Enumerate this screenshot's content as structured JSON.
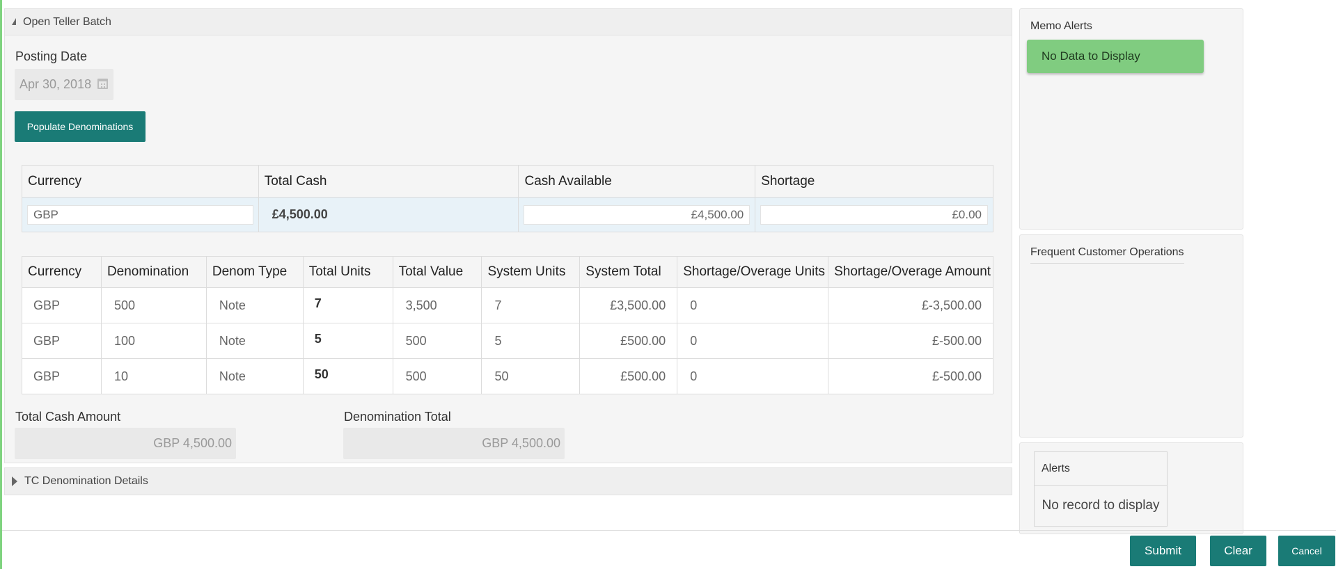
{
  "open_batch": {
    "header": "Open Teller Batch",
    "posting_date_label": "Posting Date",
    "posting_date_value": "Apr 30, 2018",
    "populate_button": "Populate Denominations"
  },
  "cash_table": {
    "columns": [
      "Currency",
      "Total Cash",
      "Cash Available",
      "Shortage"
    ],
    "row": {
      "currency": "GBP",
      "total_cash": "£4,500.00",
      "cash_available": "£4,500.00",
      "shortage": "£0.00"
    }
  },
  "denom_table": {
    "columns": [
      "Currency",
      "Denomination",
      "Denom Type",
      "Total Units",
      "Total Value",
      "System Units",
      "System Total",
      "Shortage/Overage Units",
      "Shortage/Overage Amount"
    ],
    "rows": [
      {
        "currency": "GBP",
        "denomination": "500",
        "denom_type": "Note",
        "total_units": "7",
        "total_value": "3,500",
        "system_units": "7",
        "system_total": "£3,500.00",
        "so_units": "0",
        "so_amount": "£-3,500.00"
      },
      {
        "currency": "GBP",
        "denomination": "100",
        "denom_type": "Note",
        "total_units": "5",
        "total_value": "500",
        "system_units": "5",
        "system_total": "£500.00",
        "so_units": "0",
        "so_amount": "£-500.00"
      },
      {
        "currency": "GBP",
        "denomination": "10",
        "denom_type": "Note",
        "total_units": "50",
        "total_value": "500",
        "system_units": "50",
        "system_total": "£500.00",
        "so_units": "0",
        "so_amount": "£-500.00"
      }
    ]
  },
  "totals": {
    "total_cash_label": "Total Cash Amount",
    "total_cash_value": "GBP 4,500.00",
    "denom_total_label": "Denomination Total",
    "denom_total_value": "GBP 4,500.00"
  },
  "tc_section": {
    "header": "TC Denomination Details"
  },
  "side": {
    "memo_alerts_title": "Memo Alerts",
    "memo_alerts_empty": "No Data to Display",
    "frequent_ops_title": "Frequent Customer Operations",
    "alerts_title": "Alerts",
    "alerts_empty": "No record to display"
  },
  "footer": {
    "submit": "Submit",
    "clear": "Clear",
    "cancel": "Cancel"
  },
  "colors": {
    "primary_button": "#1a7b76",
    "success_banner": "#80cc80",
    "selected_row": "#e8f2f8"
  }
}
